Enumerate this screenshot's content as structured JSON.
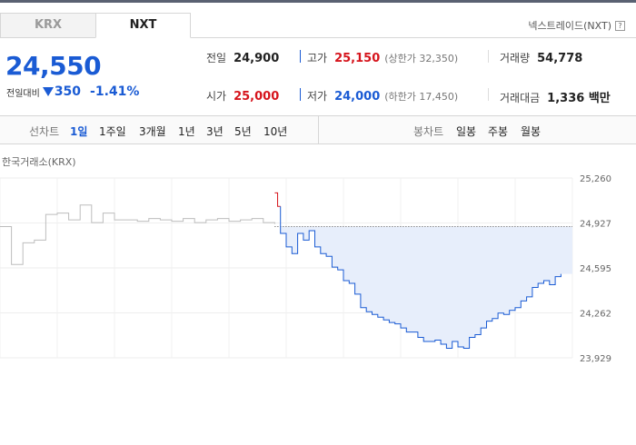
{
  "tabs": [
    {
      "label": "KRX",
      "active": false
    },
    {
      "label": "NXT",
      "active": true
    }
  ],
  "market_label": "넥스트레이드(NXT)",
  "help_icon": "?",
  "price": {
    "current": "24,550",
    "change_label": "전일대비",
    "change_value": "350",
    "change_pct": "-1.41%",
    "direction": "down"
  },
  "stats": {
    "prev_close": {
      "label": "전일",
      "value": "24,900"
    },
    "open": {
      "label": "시가",
      "value": "25,000"
    },
    "high": {
      "label": "고가",
      "value": "25,150",
      "sub": "(상한가 32,350)"
    },
    "low": {
      "label": "저가",
      "value": "24,000",
      "sub": "(하한가 17,450)"
    },
    "volume": {
      "label": "거래량",
      "value": "54,778"
    },
    "amount": {
      "label": "거래대금",
      "value": "1,336 백만"
    }
  },
  "period_bar": {
    "line_label": "선차트",
    "line_periods": [
      "1일",
      "1주일",
      "3개월",
      "1년",
      "3년",
      "5년",
      "10년"
    ],
    "active_period": "1일",
    "candle_label": "봉차트",
    "candle_periods": [
      "일봉",
      "주봉",
      "월봉"
    ]
  },
  "chart_label": "한국거래소(KRX)",
  "colors": {
    "up": "#d6141c",
    "down": "#1a5bd4",
    "krx_line": "#bdbdbd",
    "fill": "#e7eefb"
  },
  "chart_data": {
    "type": "line",
    "title": "",
    "xlabel": "",
    "ylabel": "",
    "y_ticks": [
      "25,260",
      "24,927",
      "24,595",
      "24,262",
      "23,929"
    ],
    "ylim": [
      23929,
      25260
    ],
    "baseline": 24900,
    "grid": true,
    "series": [
      {
        "name": "한국거래소(KRX)",
        "color": "#bdbdbd",
        "x": [
          0,
          0.02,
          0.04,
          0.06,
          0.08,
          0.1,
          0.12,
          0.14,
          0.16,
          0.18,
          0.2,
          0.22,
          0.24,
          0.26,
          0.28,
          0.3,
          0.32,
          0.34,
          0.36,
          0.38,
          0.4,
          0.42,
          0.44,
          0.46,
          0.48
        ],
        "y": [
          24900,
          24620,
          24780,
          24800,
          24990,
          25000,
          24950,
          25060,
          24930,
          25000,
          24950,
          24950,
          24940,
          24960,
          24950,
          24940,
          24960,
          24930,
          24950,
          24960,
          24940,
          24950,
          24960,
          24930,
          24920
        ]
      },
      {
        "name": "NXT",
        "color": "#1a5bd4",
        "x": [
          0.48,
          0.485,
          0.49,
          0.5,
          0.51,
          0.52,
          0.53,
          0.54,
          0.55,
          0.56,
          0.57,
          0.58,
          0.59,
          0.6,
          0.61,
          0.62,
          0.63,
          0.64,
          0.65,
          0.66,
          0.67,
          0.68,
          0.69,
          0.7,
          0.71,
          0.72,
          0.73,
          0.74,
          0.75,
          0.76,
          0.77,
          0.78,
          0.79,
          0.8,
          0.81,
          0.82,
          0.83,
          0.84,
          0.85,
          0.86,
          0.87,
          0.88,
          0.89,
          0.9,
          0.91,
          0.92,
          0.93,
          0.94,
          0.95,
          0.96,
          0.97,
          0.98
        ],
        "y": [
          25150,
          25050,
          24850,
          24750,
          24700,
          24850,
          24800,
          24870,
          24750,
          24700,
          24680,
          24600,
          24580,
          24500,
          24480,
          24400,
          24300,
          24270,
          24250,
          24230,
          24210,
          24190,
          24180,
          24150,
          24120,
          24120,
          24080,
          24050,
          24050,
          24060,
          24030,
          24000,
          24050,
          24010,
          24000,
          24080,
          24100,
          24150,
          24200,
          24220,
          24260,
          24250,
          24280,
          24300,
          24350,
          24380,
          24450,
          24480,
          24500,
          24470,
          24530,
          24550
        ]
      }
    ]
  }
}
